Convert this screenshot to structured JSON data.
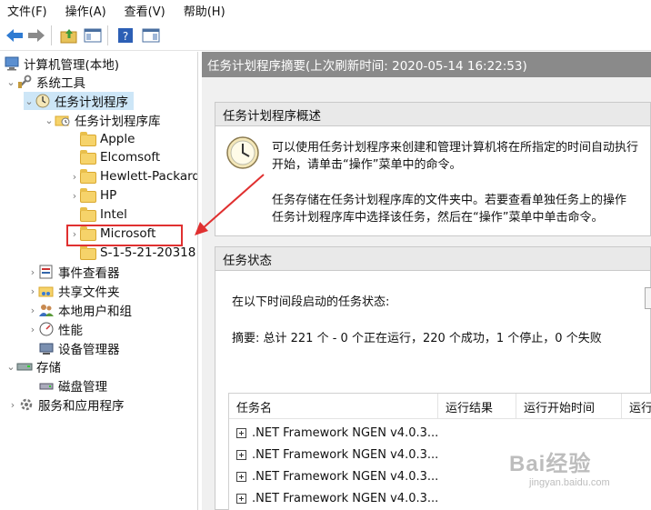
{
  "menu": [
    "文件(F)",
    "操作(A)",
    "查看(V)",
    "帮助(H)"
  ],
  "tree": {
    "root": "计算机管理(本地)",
    "system_tools": "系统工具",
    "task_scheduler": "任务计划程序",
    "task_library": "任务计划程序库",
    "folders": [
      "Apple",
      "Elcomsoft",
      "Hewlett-Packard",
      "HP",
      "Intel",
      "Microsoft",
      "S-1-5-21-20318"
    ],
    "event_viewer": "事件查看器",
    "shared_folders": "共享文件夹",
    "local_users": "本地用户和组",
    "performance": "性能",
    "device_manager": "设备管理器",
    "storage": "存储",
    "disk_management": "磁盘管理",
    "services_apps": "服务和应用程序"
  },
  "right": {
    "header": "任务计划程序摘要(上次刷新时间: 2020-05-14 16:22:53)",
    "overview": {
      "title": "任务计划程序概述",
      "line1": "可以使用任务计划程序来创建和管理计算机将在所指定的时间自动执行",
      "line2": "开始，请单击“操作”菜单中的命令。",
      "line3": "任务存储在任务计划程序库的文件夹中。若要查看单独任务上的操作",
      "line4": "任务计划程序库中选择该任务，然后在“操作”菜单中单击命令。"
    },
    "status": {
      "title": "任务状态",
      "prompt": "在以下时间段启动的任务状态:",
      "summary": "摘要: 总计 221 个 - 0 个正在运行，220 个成功，1 个停止，0 个失败",
      "columns": [
        "任务名",
        "运行结果",
        "运行开始时间",
        "运行"
      ],
      "rows": [
        ".NET Framework NGEN v4.0.3...",
        ".NET Framework NGEN v4.0.3...",
        ".NET Framework NGEN v4.0.3...",
        ".NET Framework NGEN v4.0.3..."
      ]
    }
  },
  "watermark": {
    "brand": "Bai经验",
    "url": "jingyan.baidu.com"
  },
  "colors": {
    "header_bg": "#8a8a8a",
    "highlight_box": "#e03030",
    "arrow": "#e03030",
    "selected_bg": "#cde6f7"
  }
}
